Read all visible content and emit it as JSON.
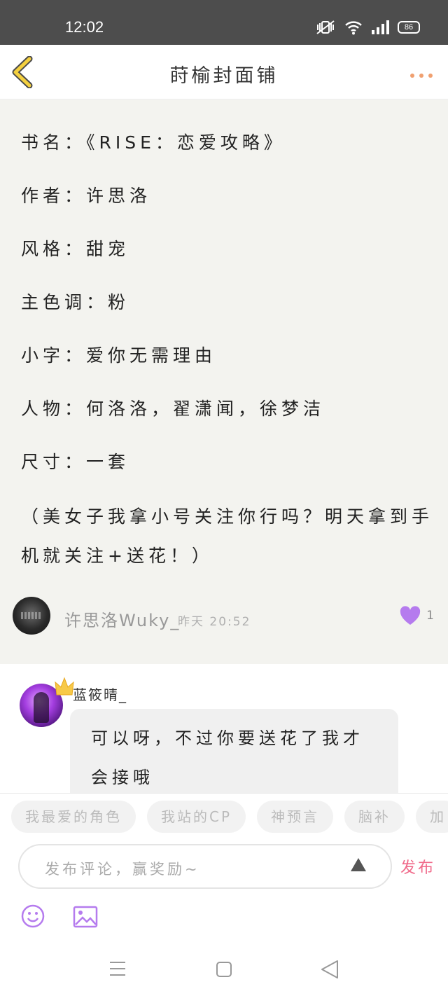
{
  "status_bar": {
    "time": "12:02",
    "battery": "86"
  },
  "nav": {
    "title": "莳榆封面铺"
  },
  "post": {
    "lines": [
      "书名：《RISE：恋爱攻略》",
      "作者：许思洛",
      "风格：甜宠",
      "主色调：粉",
      "小字：爱你无需理由",
      "人物：何洛洛，翟潇闻，徐梦洁",
      "尺寸：一套",
      "（美女子我拿小号关注你行吗？明天拿到手",
      "机就关注+送花！）"
    ],
    "author": "许思洛Wuky_",
    "time": "昨天 20:52",
    "likes": "1"
  },
  "reply": {
    "name": "蓝筱晴_",
    "text_lines": [
      "可以呀，不过你要送花了我才",
      "会接哦"
    ]
  },
  "tags": [
    "我最爱的角色",
    "我站的CP",
    "神预言",
    "脑补",
    "加"
  ],
  "comment": {
    "placeholder": "发布评论，赢奖励~",
    "publish_label": "发布"
  },
  "colors": {
    "accent_pink": "#f06a8a",
    "heart_purple": "#b57bee",
    "back_yellow": "#f4d03f"
  },
  "icons": [
    "back-icon",
    "more-icon",
    "heart-icon",
    "send-arrow-icon",
    "emoji-icon",
    "image-icon",
    "menu-icon",
    "home-icon",
    "back-triangle-icon"
  ]
}
